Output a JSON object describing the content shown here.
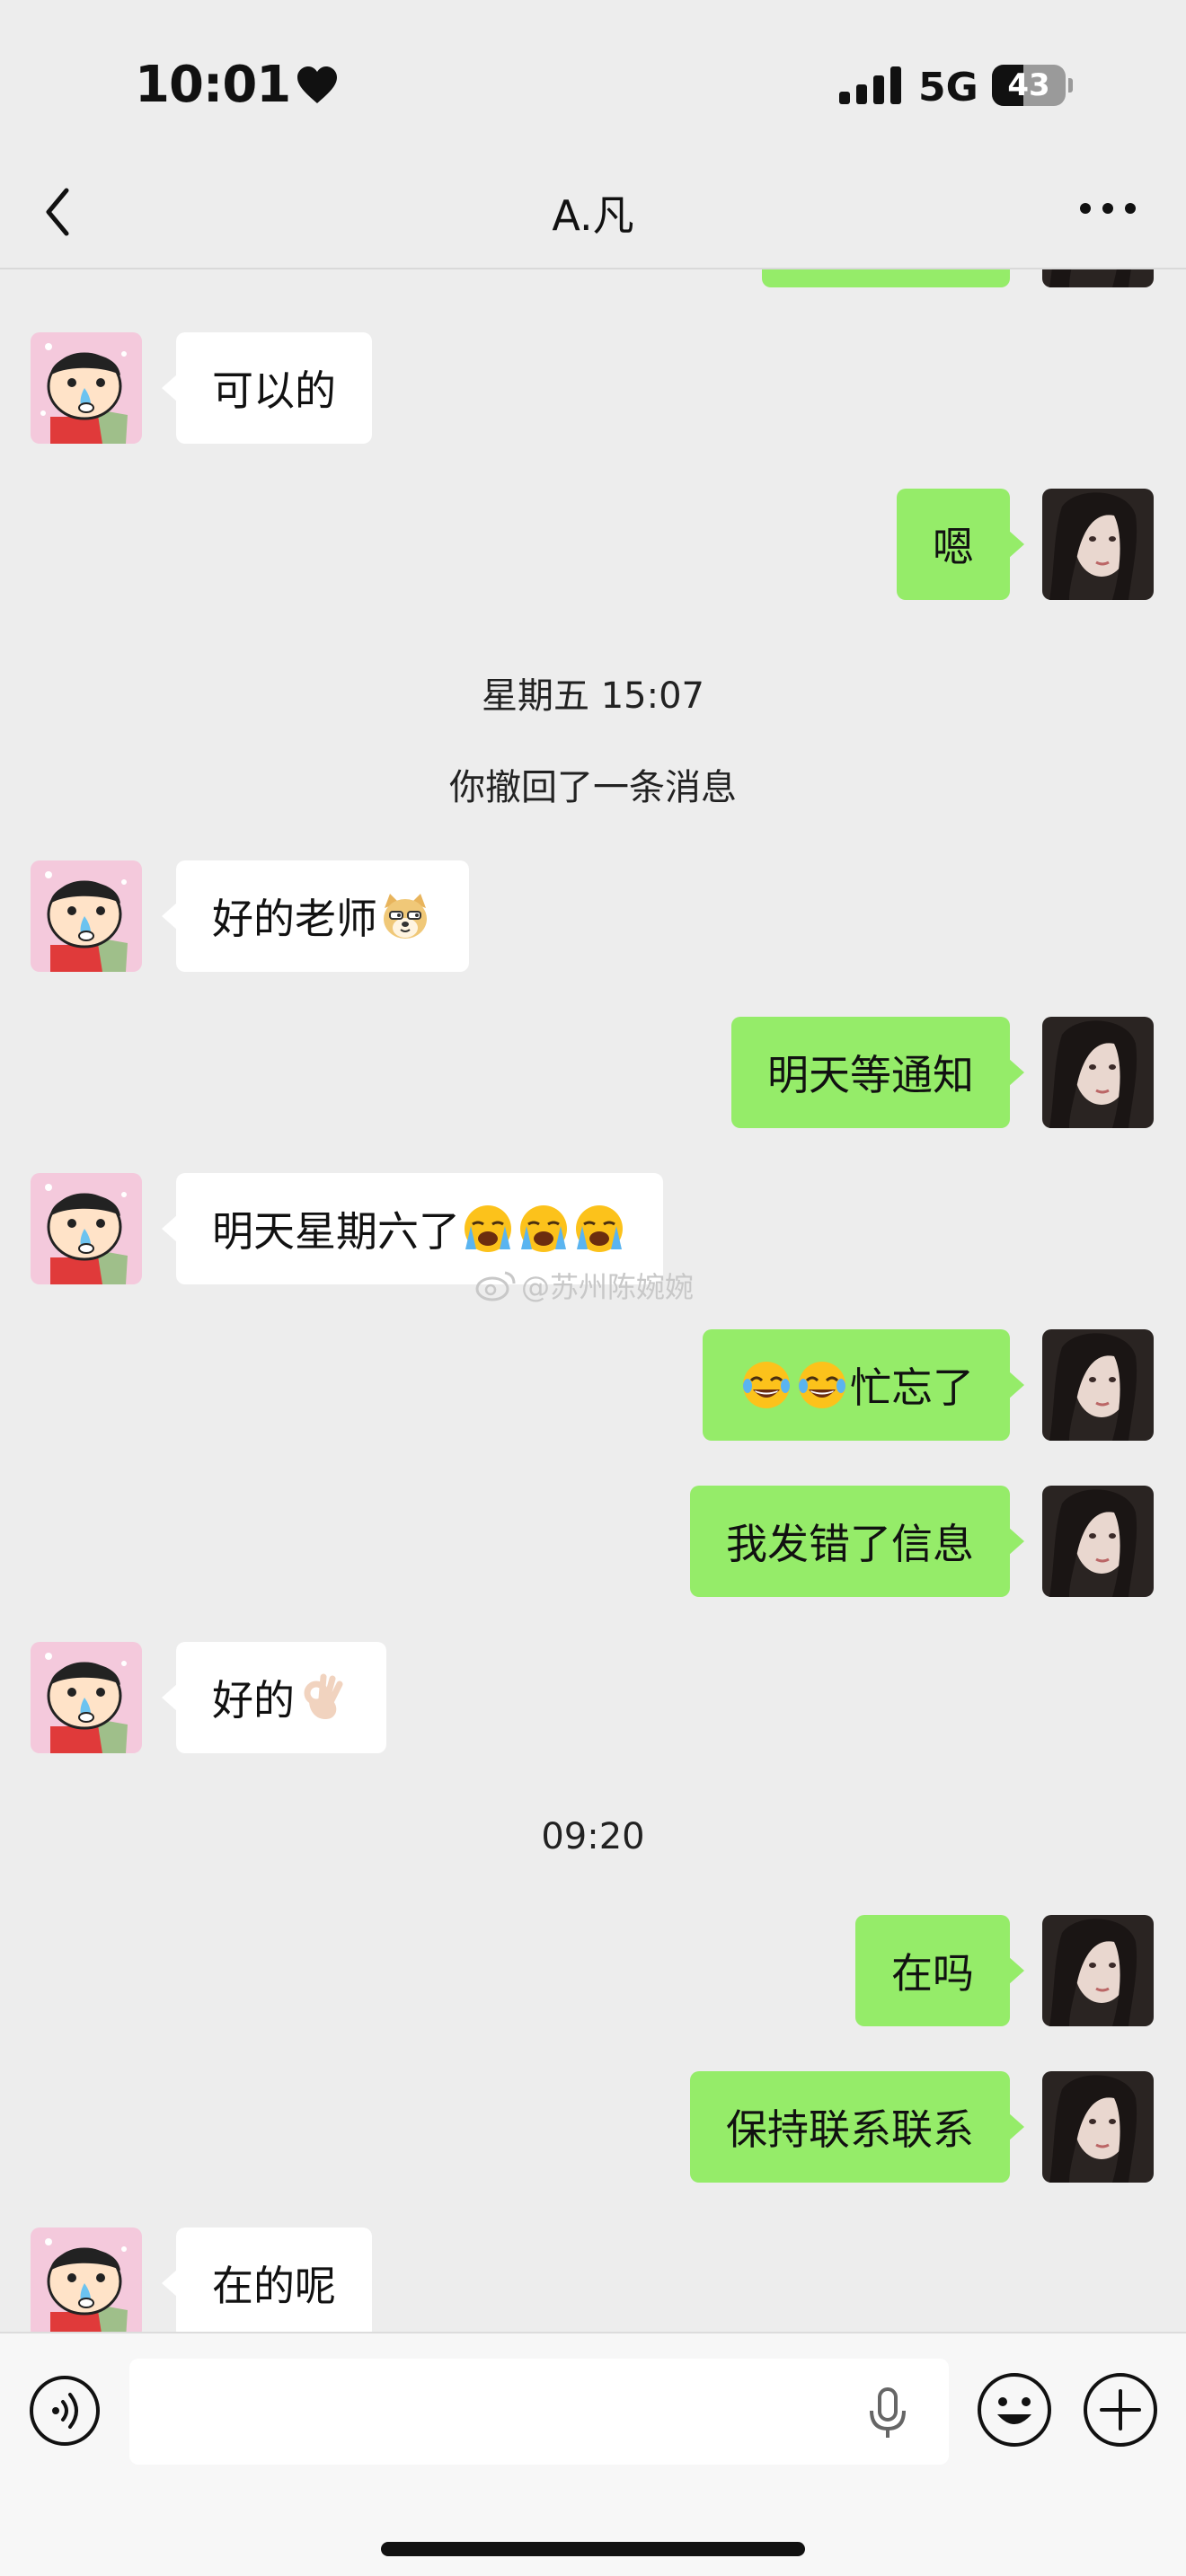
{
  "status_bar": {
    "time": "10:01",
    "network": "5G",
    "battery_level": "43",
    "battery_fraction": 0.43
  },
  "nav": {
    "title": "A.凡"
  },
  "messages": [
    {
      "side": "out",
      "text": ""
    },
    {
      "side": "in",
      "text": "可以的"
    },
    {
      "side": "out",
      "text": "嗯"
    },
    {
      "type": "system",
      "text": "星期五 15:07"
    },
    {
      "type": "system",
      "text": "你撤回了一条消息"
    },
    {
      "side": "in",
      "text": "好的老师",
      "emoji": "doge-emoji"
    },
    {
      "side": "out",
      "text": "明天等通知"
    },
    {
      "side": "in",
      "text": "明天星期六了",
      "emoji": "loudly-crying-emoji x3"
    },
    {
      "side": "out",
      "text": "忙忘了",
      "emoji": "tears-of-joy-emoji x2"
    },
    {
      "side": "out",
      "text": "我发错了信息"
    },
    {
      "side": "in",
      "text": "好的",
      "emoji": "ok-hand-emoji"
    },
    {
      "type": "system",
      "text": "09:20"
    },
    {
      "side": "out",
      "text": "在吗"
    },
    {
      "side": "out",
      "text": "保持联系联系"
    },
    {
      "side": "in",
      "text": "在的呢"
    }
  ],
  "watermark": "@苏州陈婉婉",
  "colors": {
    "background": "#ededed",
    "outgoing_bubble": "#95ec69",
    "incoming_bubble": "#ffffff"
  },
  "icons": {
    "back": "chevron-left-icon",
    "more": "more-dots-icon",
    "voice": "voice-mode-icon",
    "mic": "mic-icon",
    "emoji": "emoji-icon",
    "plus": "plus-icon"
  }
}
